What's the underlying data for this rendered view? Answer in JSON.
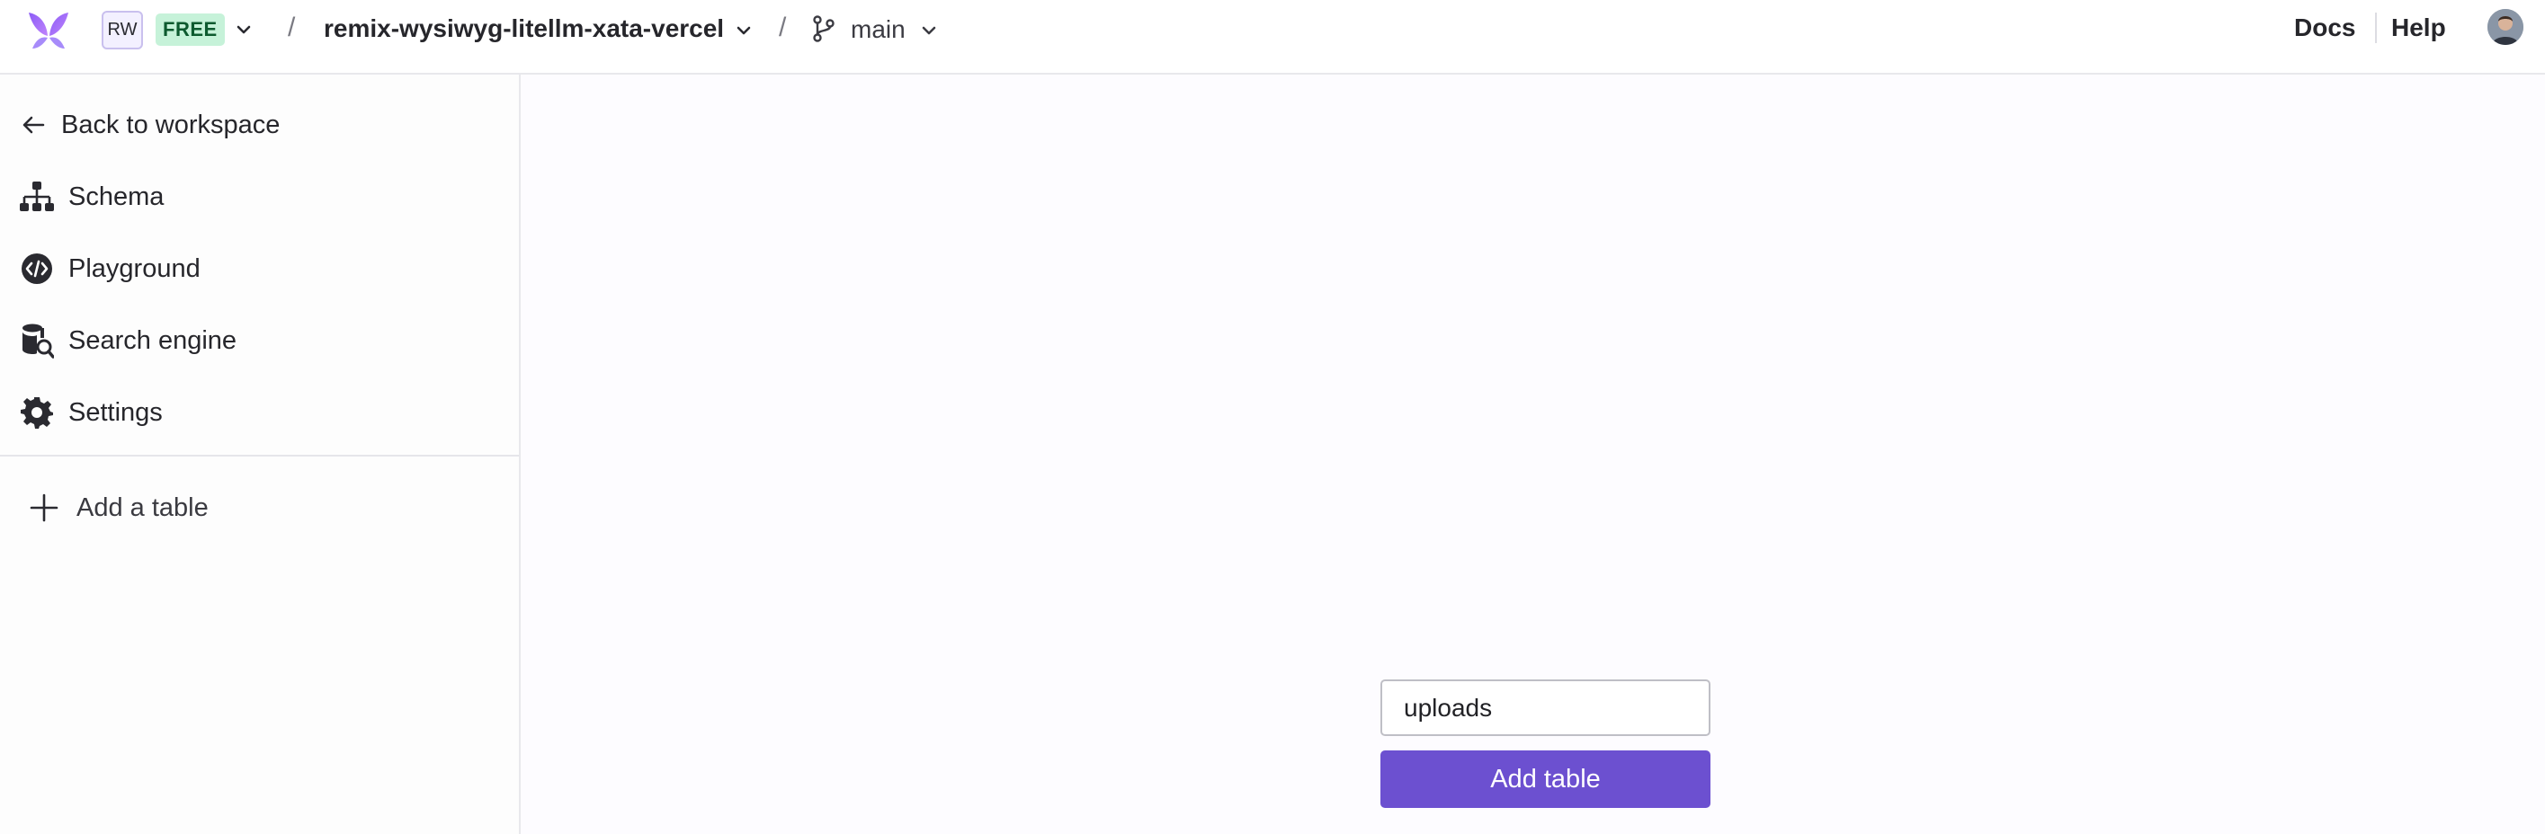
{
  "header": {
    "workspace_initials": "RW",
    "plan_badge": "FREE",
    "database_name": "remix-wysiwyg-litellm-xata-vercel",
    "branch_name": "main",
    "separator": "/",
    "docs_link": "Docs",
    "help_link": "Help"
  },
  "sidebar": {
    "back_label": "Back to workspace",
    "items": [
      {
        "label": "Schema",
        "icon": "schema-icon"
      },
      {
        "label": "Playground",
        "icon": "playground-icon"
      },
      {
        "label": "Search engine",
        "icon": "search-engine-icon"
      },
      {
        "label": "Settings",
        "icon": "gear-icon"
      }
    ],
    "add_table_label": "Add a table"
  },
  "main": {
    "new_table": {
      "input_value": "uploads",
      "button_label": "Add table"
    }
  },
  "colors": {
    "accent": "#6c50d0",
    "plan_badge_bg": "#c6f2d9",
    "plan_badge_text": "#0d5a2f"
  }
}
